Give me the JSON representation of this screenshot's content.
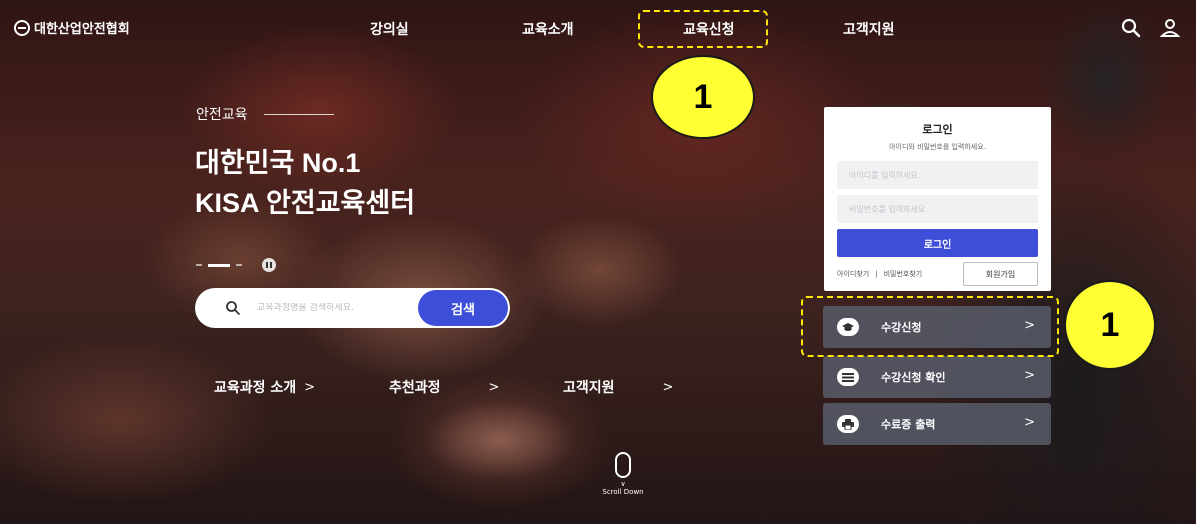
{
  "header": {
    "logo_text": "대한산업안전협회",
    "nav": [
      "강의실",
      "교육소개",
      "교육신청",
      "고객지원"
    ]
  },
  "hero": {
    "subtitle": "안전교육",
    "title_line1": "대한민국 No.1",
    "title_line2": "KISA 안전교육센터"
  },
  "search": {
    "placeholder": "교육과정명을 검색하세요.",
    "button": "검색"
  },
  "quick_links": [
    "교육과정 소개",
    "추천과정",
    "고객지원"
  ],
  "scroll_label": "Scroll Down",
  "login": {
    "title": "로그인",
    "description": "아이디와 비밀번호를 입력하세요.",
    "id_placeholder": "아이디를 입력하세요.",
    "pw_placeholder": "비밀번호를 입력하세요.",
    "submit": "로그인",
    "find_id": "아이디찾기",
    "separator": "|",
    "find_pw": "비밀번호찾기",
    "signup": "회원가입"
  },
  "actions": [
    {
      "label": "수강신청",
      "icon": "graduation-cap-icon"
    },
    {
      "label": "수강신청 확인",
      "icon": "list-icon"
    },
    {
      "label": "수료증 출력",
      "icon": "printer-icon"
    }
  ],
  "annotations": {
    "badge_nav": "1",
    "badge_side": "1",
    "highlight_color": "#ffe600"
  },
  "colors": {
    "accent": "#3d4fd8",
    "badge": "#ffff33"
  }
}
